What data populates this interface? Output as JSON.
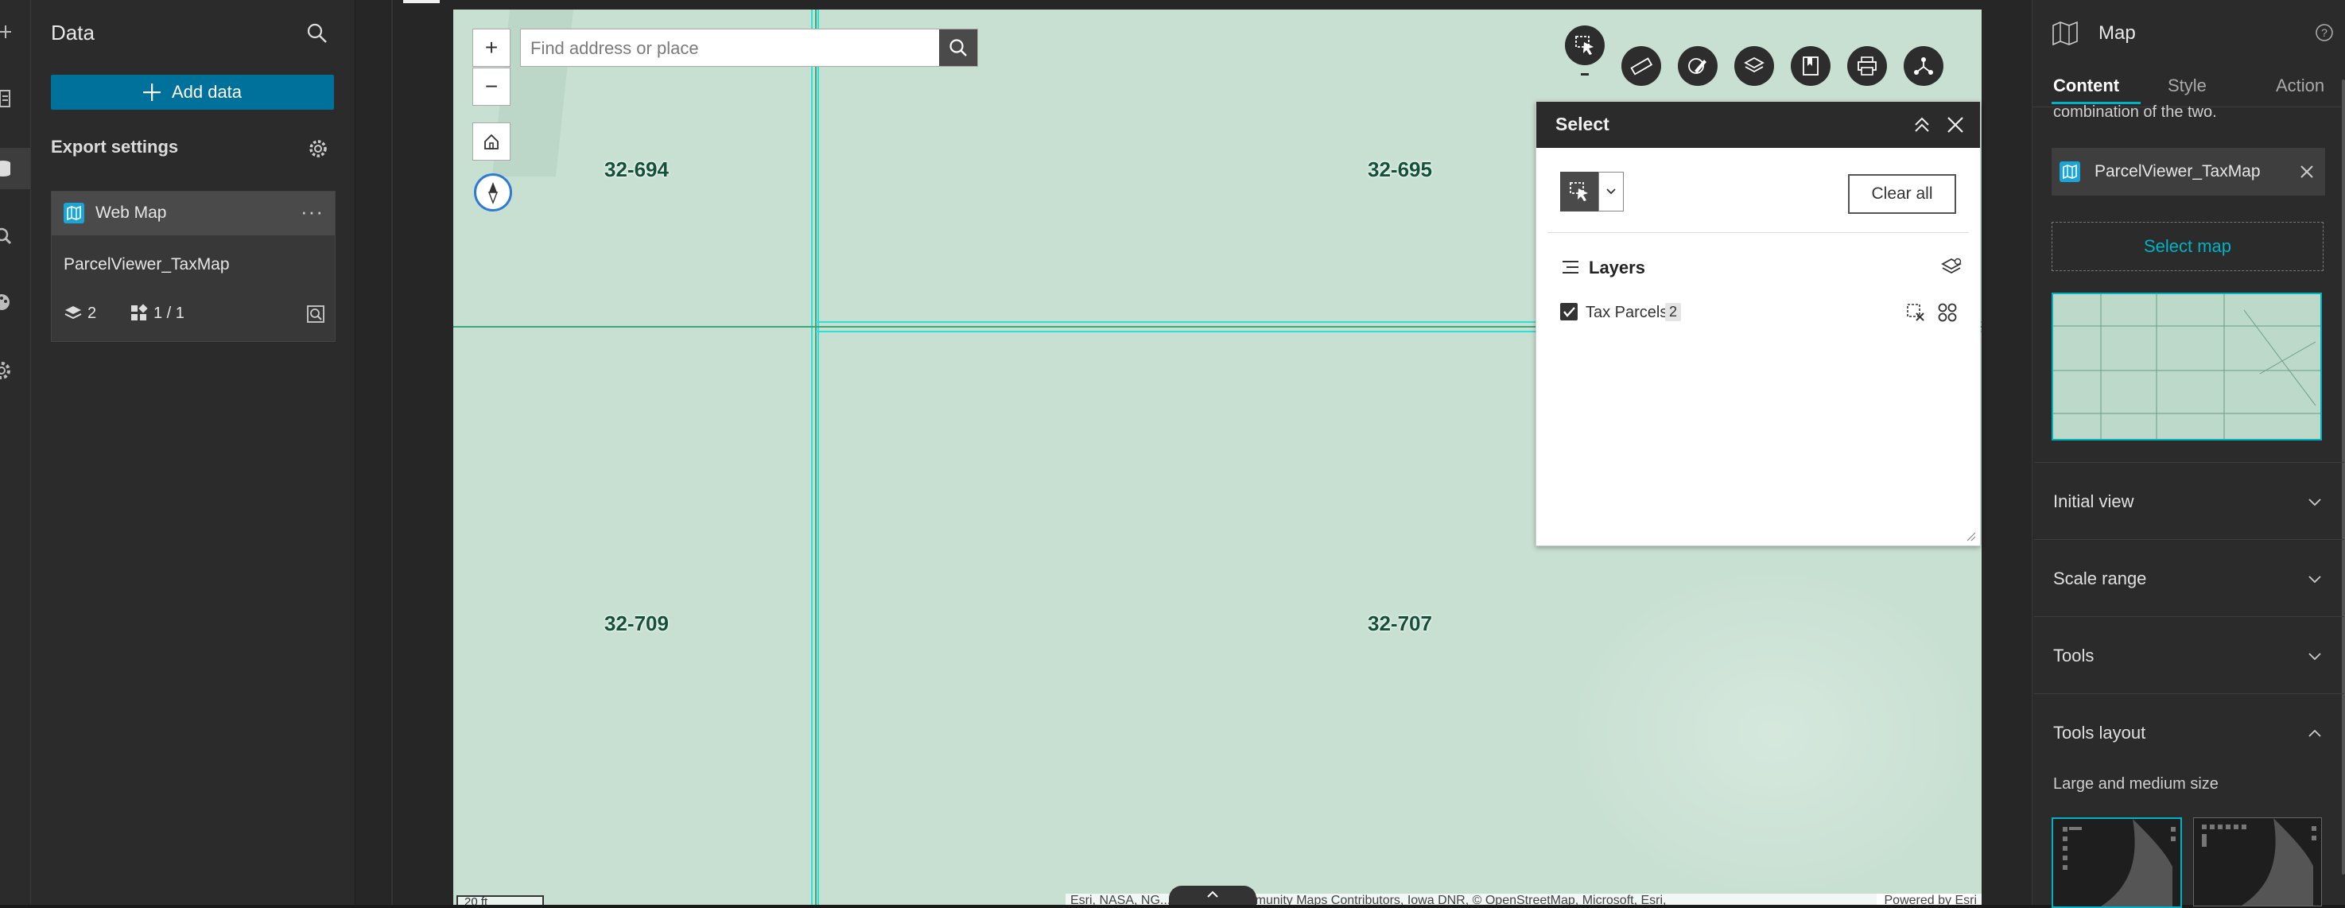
{
  "left_rail": {
    "icons": [
      "plus-icon",
      "page-icon",
      "data-icon",
      "search-icon",
      "palette-icon",
      "gear-icon"
    ]
  },
  "data_panel": {
    "title": "Data",
    "add_data_label": "Add data",
    "export_settings_label": "Export settings",
    "web_map": {
      "type_label": "Web Map",
      "name": "ParcelViewer_TaxMap",
      "layer_count": "2",
      "widget_count": "1 / 1"
    }
  },
  "map": {
    "search_placeholder": "Find address or place",
    "zoom_in_label": "+",
    "zoom_out_label": "−",
    "parcels": [
      "32-694",
      "32-695",
      "32-709",
      "32-707"
    ],
    "scale_label": "20 ft",
    "attribution": "Esri, NASA, NG... ...A | Esri Community Maps Contributors, Iowa DNR, © OpenStreetMap, Microsoft, Esri,",
    "powered_by": "Powered by Esri",
    "colors": {
      "map_fill": "#c8e0d2",
      "parcel_line": "#3fa57a",
      "selected_line": "#2de0d8"
    }
  },
  "select_panel": {
    "title": "Select",
    "clear_all_label": "Clear all",
    "layers_heading": "Layers",
    "layer_name": "Tax Parcels",
    "layer_count": "2"
  },
  "right_panel": {
    "title": "Map",
    "tabs": [
      "Content",
      "Style",
      "Action"
    ],
    "active_tab": "Content",
    "description_tail": "combination of the two.",
    "selected_map": "ParcelViewer_TaxMap",
    "select_map_label": "Select map",
    "sections": [
      {
        "label": "Initial view",
        "expanded": false
      },
      {
        "label": "Scale range",
        "expanded": false
      },
      {
        "label": "Tools",
        "expanded": false
      },
      {
        "label": "Tools layout",
        "expanded": true
      }
    ],
    "tools_layout_subtitle": "Large and medium size",
    "accent_color": "#00b3c4"
  }
}
